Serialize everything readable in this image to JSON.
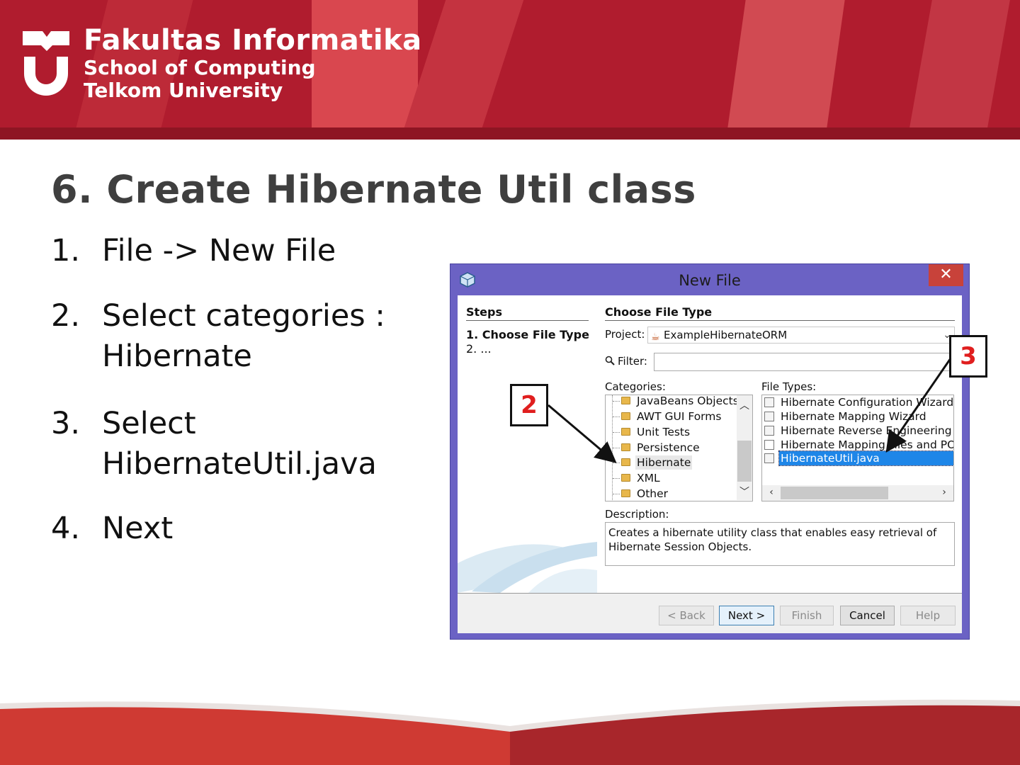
{
  "header": {
    "brand_line1": "Fakultas Informatika",
    "brand_line2": "School of Computing",
    "brand_line3": "Telkom University",
    "colors": {
      "banner": "#b01c2e",
      "banner_dark": "#8e1523",
      "banner_light": "#d9474f"
    }
  },
  "slide": {
    "title": "6. Create Hibernate Util class",
    "steps": [
      {
        "num": "1.",
        "text": "File -> New File"
      },
      {
        "num": "2.",
        "text": "Select categories : Hibernate"
      },
      {
        "num": "3.",
        "text": "Select HibernateUtil.java"
      },
      {
        "num": "4.",
        "text": "Next"
      }
    ]
  },
  "dialog": {
    "title": "New File",
    "close_label": "✕",
    "steps_pane": {
      "heading": "Steps",
      "step1": "1.  Choose File Type",
      "step2": "2.  ..."
    },
    "section_title": "Choose File Type",
    "project_label": "Project:",
    "project_value": "ExampleHibernateORM",
    "filter_label": "Filter:",
    "filter_value": "",
    "categories_label": "Categories:",
    "categories": [
      "JavaBeans Objects",
      "AWT GUI Forms",
      "Unit Tests",
      "Persistence",
      "Hibernate",
      "XML",
      "Other"
    ],
    "selected_category": "Hibernate",
    "file_types_label": "File Types:",
    "file_types": [
      "Hibernate Configuration Wizard",
      "Hibernate Mapping Wizard",
      "Hibernate Reverse Engineering Wiz",
      "Hibernate Mapping Files and POJOs",
      "HibernateUtil.java"
    ],
    "selected_file_type": "HibernateUtil.java",
    "description_label": "Description:",
    "description": "Creates a hibernate utility class that enables easy retrieval of Hibernate Session Objects.",
    "buttons": {
      "back": "< Back",
      "next": "Next >",
      "finish": "Finish",
      "cancel": "Cancel",
      "help": "Help"
    },
    "colors": {
      "frame": "#6b62c4",
      "close": "#c8423a",
      "selection": "#1e86e8"
    }
  },
  "callouts": {
    "two": "2",
    "three": "3"
  }
}
